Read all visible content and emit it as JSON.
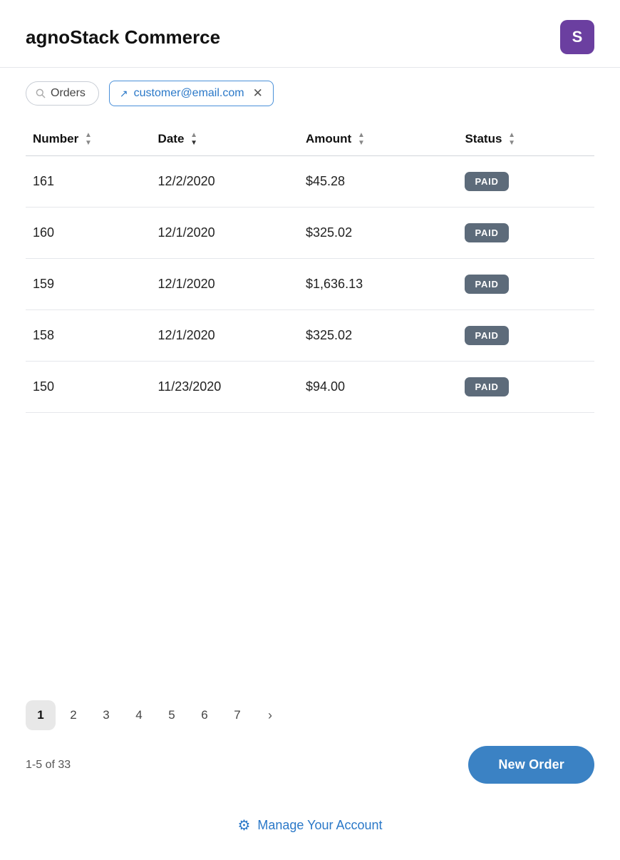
{
  "app": {
    "title": "agnoStack Commerce",
    "avatar_letter": "S",
    "avatar_color": "#6b3fa0"
  },
  "toolbar": {
    "search_label": "Orders",
    "customer_email": "customer@email.com"
  },
  "table": {
    "columns": [
      {
        "key": "number",
        "label": "Number",
        "sort": "both"
      },
      {
        "key": "date",
        "label": "Date",
        "sort": "desc"
      },
      {
        "key": "amount",
        "label": "Amount",
        "sort": "both"
      },
      {
        "key": "status",
        "label": "Status",
        "sort": "both"
      }
    ],
    "rows": [
      {
        "number": "161",
        "date": "12/2/2020",
        "amount": "$45.28",
        "status": "PAID"
      },
      {
        "number": "160",
        "date": "12/1/2020",
        "amount": "$325.02",
        "status": "PAID"
      },
      {
        "number": "159",
        "date": "12/1/2020",
        "amount": "$1,636.13",
        "status": "PAID"
      },
      {
        "number": "158",
        "date": "12/1/2020",
        "amount": "$325.02",
        "status": "PAID"
      },
      {
        "number": "150",
        "date": "11/23/2020",
        "amount": "$94.00",
        "status": "PAID"
      }
    ]
  },
  "pagination": {
    "pages": [
      "1",
      "2",
      "3",
      "4",
      "5",
      "6",
      "7"
    ],
    "active_page": "1",
    "next_label": "›"
  },
  "footer": {
    "results_count": "1-5 of 33",
    "new_order_label": "New Order"
  },
  "manage_account": {
    "label": "Manage Your Account",
    "icon": "⚙"
  }
}
